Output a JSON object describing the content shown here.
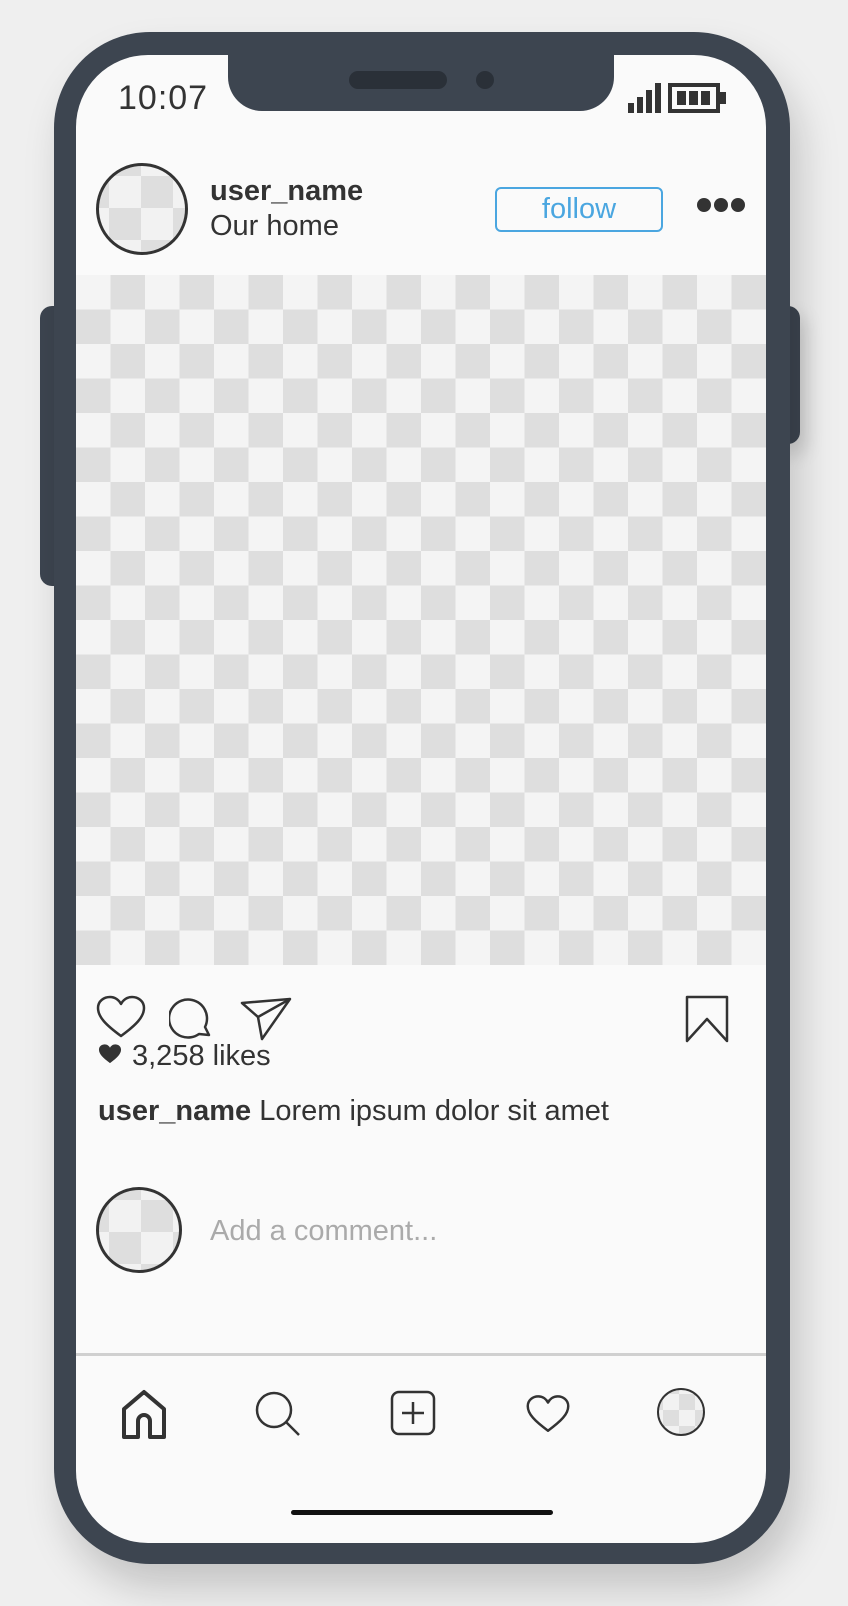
{
  "status_bar": {
    "time": "10:07",
    "icons": [
      "signal-icon",
      "battery-icon"
    ]
  },
  "post_header": {
    "username": "user_name",
    "location": "Our home",
    "follow_label": "follow",
    "more_icon": "more-dots-icon"
  },
  "actions": {
    "icons": [
      "heart-icon",
      "comment-icon",
      "share-icon",
      "bookmark-icon"
    ]
  },
  "likes": {
    "count_text": "3,258 likes"
  },
  "caption": {
    "username": "user_name",
    "text": "Lorem ipsum dolor sit amet"
  },
  "comment": {
    "placeholder": "Add a comment..."
  },
  "bottom_nav": {
    "items": [
      "home-icon",
      "search-icon",
      "add-post-icon",
      "activity-heart-icon",
      "profile-avatar"
    ]
  },
  "colors": {
    "frame": "#3d4550",
    "accent": "#4aa6e0",
    "screen": "#fafafa",
    "text": "#333333"
  }
}
